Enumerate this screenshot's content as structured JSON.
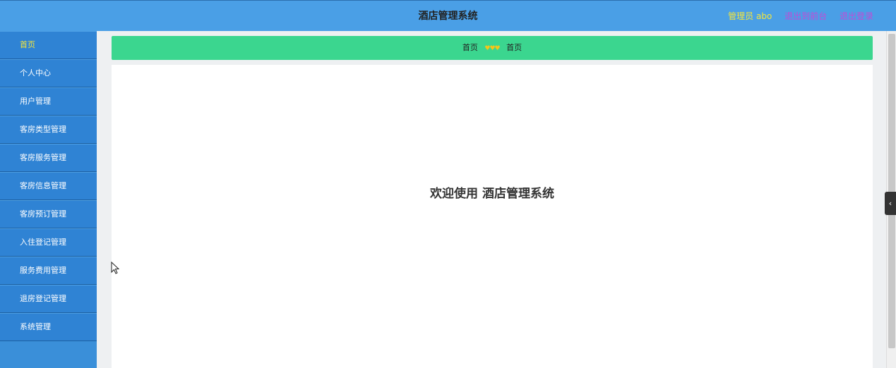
{
  "header": {
    "title": "酒店管理系统",
    "admin": "管理员 abo",
    "front_link": "退出到前台",
    "logout_link": "退出登录"
  },
  "sidebar": {
    "items": [
      {
        "label": "首页"
      },
      {
        "label": "个人中心"
      },
      {
        "label": "用户管理"
      },
      {
        "label": "客房类型管理"
      },
      {
        "label": "客房服务管理"
      },
      {
        "label": "客房信息管理"
      },
      {
        "label": "客房预订管理"
      },
      {
        "label": "入住登记管理"
      },
      {
        "label": "服务费用管理"
      },
      {
        "label": "退房登记管理"
      },
      {
        "label": "系统管理"
      }
    ]
  },
  "breadcrumb": {
    "root": "首页",
    "separator": "♥♥♥",
    "current": "首页"
  },
  "main": {
    "welcome": "欢迎使用 酒店管理系统"
  },
  "colors": {
    "header_bg": "#4a9fe6",
    "sidebar_bg": "#2f83d4",
    "breadcrumb_bg": "#3bd68f",
    "admin_text": "#f5e63a",
    "link_text": "#c24bd6"
  }
}
